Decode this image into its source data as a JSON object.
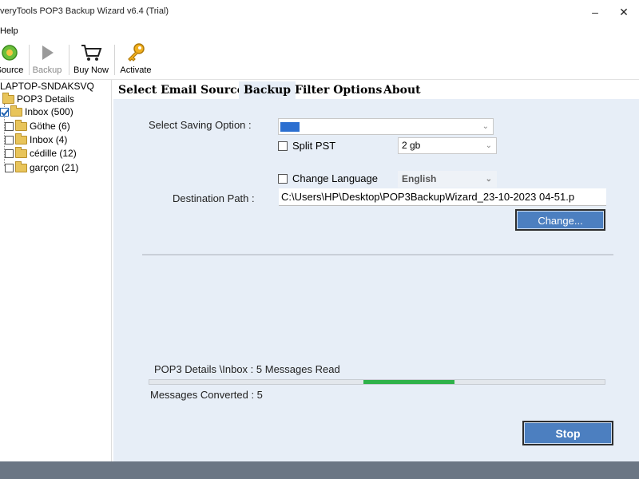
{
  "window": {
    "title": "veryTools POP3 Backup Wizard v6.4 (Trial)",
    "minimize": "–",
    "close": "✕"
  },
  "menu": {
    "help": "Help"
  },
  "toolbar": {
    "source": "Source",
    "backup": "Backup",
    "buy_now": "Buy Now",
    "activate": "Activate"
  },
  "tree": {
    "root": "LAPTOP-SNDAKSVQ",
    "pop3": "POP3 Details",
    "inbox": "Inbox (500)",
    "folders": [
      "Göthe (6)",
      "Inbox (4)",
      "cédille (12)",
      "garçon (21)"
    ]
  },
  "tabs": [
    "Select Email Source",
    "Backup",
    "Filter Options",
    "About"
  ],
  "backup": {
    "saving_option_label": "Select Saving Option :",
    "saving_option_value": "",
    "split_pst_label": "Split PST",
    "split_pst_size": "2 gb",
    "change_language_label": "Change Language",
    "language_value": "English",
    "destination_label": "Destination Path :",
    "destination_value": "C:\\Users\\HP\\Desktop\\POP3BackupWizard_23-10-2023 04-51.p",
    "change_button": "Change...",
    "status_text": "POP3 Details \\Inbox : 5 Messages Read",
    "progress": 0.45,
    "converted_text": "Messages Converted : 5",
    "stop_button": "Stop"
  },
  "colors": {
    "panel_bg": "#e7eef7",
    "button": "#4c7fc0",
    "progress": "#2fb24a",
    "accent": "#2c6fd0"
  }
}
